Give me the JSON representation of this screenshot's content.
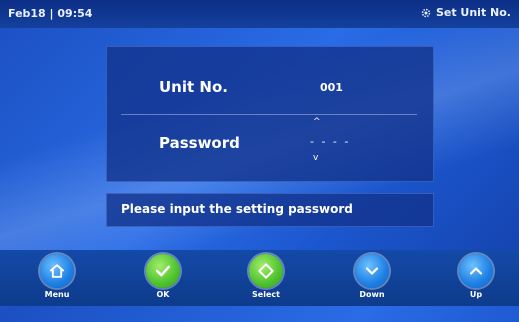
{
  "status_bar": {
    "date_time": "Feb18 | 09:54",
    "setting_title": "Set Unit No."
  },
  "form": {
    "unit_label": "Unit No.",
    "unit_value": "001",
    "password_label": "Password",
    "password_value": "- - - -",
    "caret_up": "^",
    "caret_down": "v"
  },
  "message": "Please input the setting password",
  "nav": {
    "menu": "Menu",
    "ok": "OK",
    "select": "Select",
    "down": "Down",
    "up": "Up"
  },
  "colors": {
    "background": "#2a6ce6",
    "panel": "#12328c",
    "nav_blue": "#1c7fe4",
    "nav_green": "#4cc22d"
  },
  "icons": {
    "status": "gear-icon",
    "menu": "home-icon",
    "ok": "check-icon",
    "select": "diamond-arrows-icon",
    "down": "chevron-down-icon",
    "up": "chevron-up-icon"
  }
}
